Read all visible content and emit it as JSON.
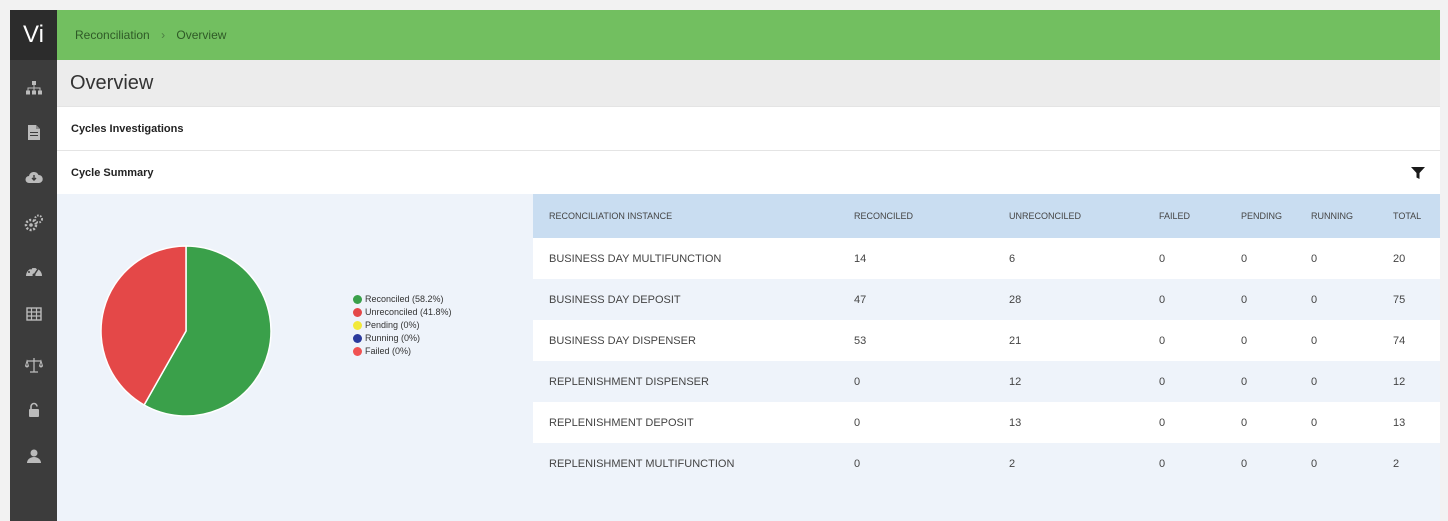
{
  "app": {
    "logo": "Vi"
  },
  "breadcrumb": {
    "items": [
      "Reconciliation",
      "Overview"
    ],
    "separator": "›"
  },
  "page": {
    "title": "Overview"
  },
  "sections": {
    "investigations": "Cycles Investigations",
    "summary": "Cycle Summary"
  },
  "sidebar": {
    "icons": [
      "sitemap-icon",
      "document-icon",
      "cloud-icon",
      "cogs-icon",
      "dashboard-icon",
      "table-icon",
      "scales-icon",
      "unlock-icon",
      "user-icon"
    ]
  },
  "colors": {
    "topbar": "#72bf60",
    "sidebar": "#3c3c3c",
    "header_row": "#c9ddf1"
  },
  "chart_data": {
    "type": "pie",
    "slices": [
      {
        "label": "Reconciled (58.2%)",
        "value": 58.2,
        "color": "#3aa04a"
      },
      {
        "label": "Unreconciled (41.8%)",
        "value": 41.8,
        "color": "#e44848"
      },
      {
        "label": "Pending (0%)",
        "value": 0,
        "color": "#f2e93a"
      },
      {
        "label": "Running (0%)",
        "value": 0,
        "color": "#2b3a9c"
      },
      {
        "label": "Failed (0%)",
        "value": 0,
        "color": "#f05252"
      }
    ],
    "legend": "right"
  },
  "table": {
    "columns": [
      "RECONCILIATION INSTANCE",
      "RECONCILED",
      "UNRECONCILED",
      "FAILED",
      "PENDING",
      "RUNNING",
      "TOTAL"
    ],
    "rows": [
      [
        "BUSINESS DAY MULTIFUNCTION",
        "14",
        "6",
        "0",
        "0",
        "0",
        "20"
      ],
      [
        "BUSINESS DAY DEPOSIT",
        "47",
        "28",
        "0",
        "0",
        "0",
        "75"
      ],
      [
        "BUSINESS DAY DISPENSER",
        "53",
        "21",
        "0",
        "0",
        "0",
        "74"
      ],
      [
        "REPLENISHMENT DISPENSER",
        "0",
        "12",
        "0",
        "0",
        "0",
        "12"
      ],
      [
        "REPLENISHMENT DEPOSIT",
        "0",
        "13",
        "0",
        "0",
        "0",
        "13"
      ],
      [
        "REPLENISHMENT MULTIFUNCTION",
        "0",
        "2",
        "0",
        "0",
        "0",
        "2"
      ]
    ]
  }
}
